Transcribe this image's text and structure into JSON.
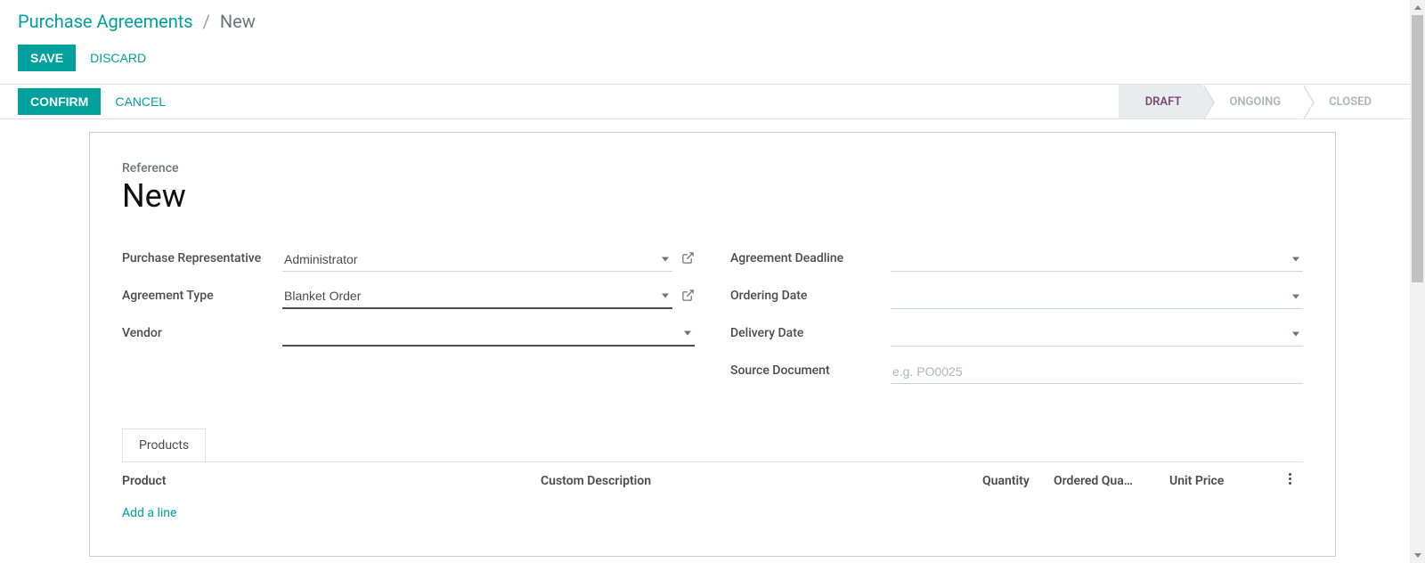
{
  "breadcrumb": {
    "root": "Purchase Agreements",
    "sep": "/",
    "current": "New"
  },
  "topActions": {
    "save": "SAVE",
    "discard": "DISCARD"
  },
  "statusActions": {
    "confirm": "CONFIRM",
    "cancel": "CANCEL"
  },
  "statusSteps": {
    "draft": "DRAFT",
    "ongoing": "ONGOING",
    "closed": "CLOSED"
  },
  "reference": {
    "label": "Reference",
    "value": "New"
  },
  "fields": {
    "purchase_rep": {
      "label": "Purchase Representative",
      "value": "Administrator"
    },
    "agreement_type": {
      "label": "Agreement Type",
      "value": "Blanket Order"
    },
    "vendor": {
      "label": "Vendor",
      "value": ""
    },
    "deadline": {
      "label": "Agreement Deadline",
      "value": ""
    },
    "ordering_date": {
      "label": "Ordering Date",
      "value": ""
    },
    "delivery_date": {
      "label": "Delivery Date",
      "value": ""
    },
    "source_doc": {
      "label": "Source Document",
      "value": "",
      "placeholder": "e.g. PO0025"
    }
  },
  "tabs": {
    "products": "Products"
  },
  "table": {
    "headers": {
      "product": "Product",
      "description": "Custom Description",
      "quantity": "Quantity",
      "ordered": "Ordered Qua…",
      "price": "Unit Price"
    },
    "add_line": "Add a line"
  }
}
